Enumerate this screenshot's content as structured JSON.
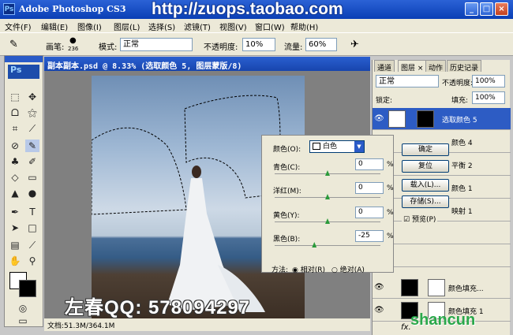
{
  "app": {
    "title": "Adobe Photoshop CS3",
    "logo": "Ps"
  },
  "watermark_top": "http://zuops.taobao.com",
  "watermark_bottom": "左春QQ: 578094297",
  "watermark_site": "shancun",
  "window_buttons": [
    "_",
    "□",
    "×"
  ],
  "menu": [
    "文件(F)",
    "编辑(E)",
    "图像(I)",
    "图层(L)",
    "选择(S)",
    "滤镜(T)",
    "视图(V)",
    "窗口(W)",
    "帮助(H)"
  ],
  "options": {
    "brush_label": "画笔:",
    "brush_size": "236",
    "mode_label": "模式:",
    "mode_value": "正常",
    "opacity_label": "不透明度:",
    "opacity_value": "10%",
    "flow_label": "流量:",
    "flow_value": "60%"
  },
  "document": {
    "title": "副本副本.psd @ 8.33% (选取颜色 5, 图层蒙版/8)",
    "status": "文档:51.3M/364.1M"
  },
  "dialog": {
    "colors_label": "颜色(O):",
    "colors_value": "白色",
    "rows": [
      {
        "label": "青色(C):",
        "value": "0",
        "unit": "%",
        "level": 0.5
      },
      {
        "label": "洋红(M):",
        "value": "0",
        "unit": "%",
        "level": 0.5
      },
      {
        "label": "黄色(Y):",
        "value": "0",
        "unit": "%",
        "level": 0.5
      },
      {
        "label": "黑色(B):",
        "value": "-25",
        "unit": "%",
        "level": 0.375
      }
    ],
    "method_label": "方法:",
    "method_relative": "相对(R)",
    "method_absolute": "绝对(A)",
    "btn_ok": "确定",
    "btn_reset": "复位",
    "btn_load": "载入(L)...",
    "btn_save": "存储(S)...",
    "preview_label": "预览(P)"
  },
  "panel": {
    "tabs": [
      "通道",
      "图层 ×",
      "动作",
      "历史记录"
    ],
    "blend_mode": "正常",
    "opacity_label": "不透明度:",
    "opacity_value": "100%",
    "lock_label": "锁定:",
    "fill_label": "填充:",
    "fill_value": "100%",
    "layers": [
      {
        "name": "选取颜色 5",
        "selected": true
      },
      {
        "name": "颜色 4",
        "selected": false
      },
      {
        "name": "平衡 2",
        "selected": false
      },
      {
        "name": "颜色 1",
        "selected": false
      },
      {
        "name": "映射 1",
        "selected": false
      },
      {
        "name": "",
        "selected": false
      },
      {
        "name": "",
        "selected": false
      },
      {
        "name": "颜色填充...",
        "selected": false
      },
      {
        "name": "颜色填充 1",
        "selected": false
      }
    ]
  }
}
